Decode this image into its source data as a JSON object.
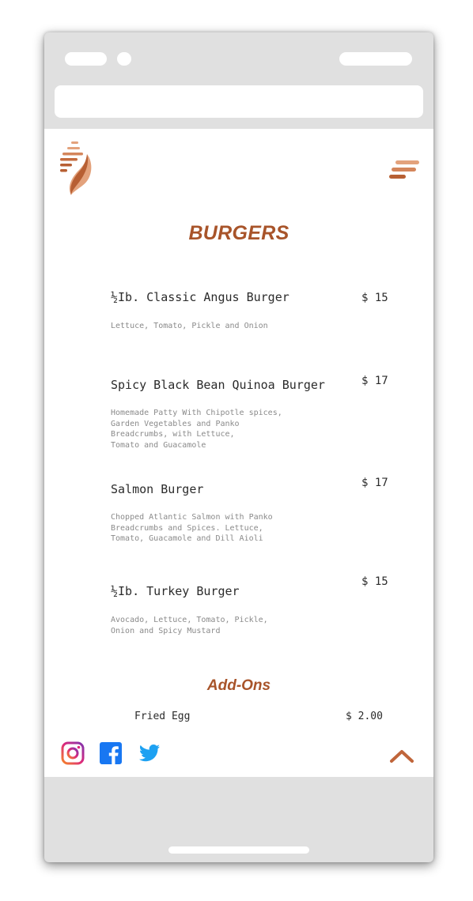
{
  "menu": {
    "title": "BURGERS",
    "items": [
      {
        "name": "½Ib. Classic Angus Burger",
        "price": "$ 15",
        "description": "Lettuce, Tomato, Pickle and Onion"
      },
      {
        "name": "Spicy Black Bean Quinoa Burger",
        "price": "$ 17",
        "description": "Homemade Patty With Chipotle spices,\nGarden Vegetables and Panko\nBreadcrumbs, with Lettuce,\nTomato and Guacamole"
      },
      {
        "name": "Salmon Burger",
        "price": "$ 17",
        "description": "Chopped Atlantic Salmon with Panko\nBreadcrumbs and Spices. Lettuce,\nTomato, Guacamole and Dill Aioli"
      },
      {
        "name": "½Ib. Turkey Burger",
        "price": "$ 15",
        "description": "Avocado, Lettuce, Tomato, Pickle,\nOnion and Spicy Mustard"
      }
    ],
    "addons_title": "Add-Ons",
    "addons": [
      {
        "name": "Fried Egg",
        "price": "$ 2.00"
      }
    ]
  },
  "icons": {
    "logo": "flame-logo",
    "menu": "hamburger-menu-icon",
    "social": [
      "instagram-icon",
      "facebook-icon",
      "twitter-icon"
    ],
    "scroll_top": "chevron-up-icon"
  },
  "colors": {
    "accent": "#a8542a",
    "logo_light": "#e3a27c",
    "logo_dark": "#b75f33",
    "facebook": "#1877f2",
    "twitter": "#1da1f2"
  }
}
